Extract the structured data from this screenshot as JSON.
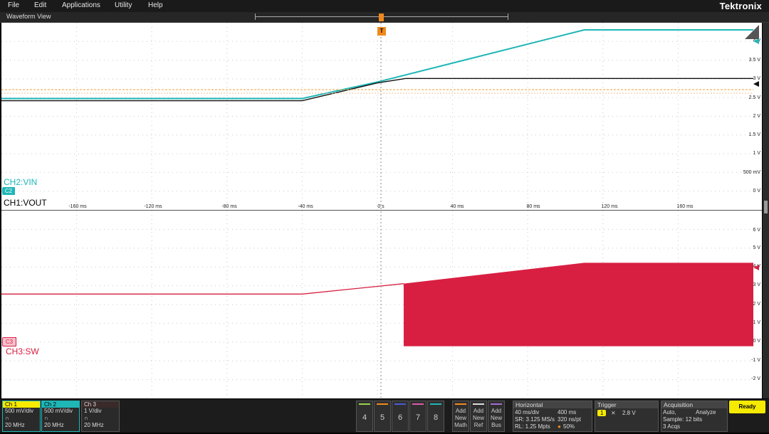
{
  "menubar": {
    "items": [
      "File",
      "Edit",
      "Applications",
      "Utility",
      "Help"
    ],
    "brand": "Tektronix"
  },
  "waveform_view": {
    "title": "Waveform View",
    "trigger_marker": "T",
    "channels": {
      "ch2": {
        "label": "CH2:VIN",
        "badge": "C2",
        "color": "#1fb6b6"
      },
      "ch1": {
        "label": "CH1:VOUT",
        "color": "#111111"
      },
      "ch3": {
        "label": "CH3:SW",
        "badge": "C3",
        "color": "#d81f42"
      }
    },
    "upper_volt_labels": [
      "4 V",
      "3.5 V",
      "3 V",
      "2.5 V",
      "2 V",
      "1.5 V",
      "1 V",
      "500 mV",
      "0 V"
    ],
    "lower_volt_labels": [
      "6 V",
      "5 V",
      "4 V",
      "3 V",
      "2 V",
      "1 V",
      "0 V",
      "-1 V",
      "-2 V"
    ],
    "time_labels": [
      "-160 ms",
      "-120 ms",
      "-80 ms",
      "-40 ms",
      "0 s",
      "40 ms",
      "80 ms",
      "120 ms",
      "160 ms"
    ]
  },
  "chart_data": {
    "type": "line",
    "x_unit": "ms",
    "xlim": [
      -200,
      200
    ],
    "panels": [
      {
        "ylim": [
          0,
          4.2
        ],
        "series": [
          {
            "name": "CH2:VIN",
            "color": "#1fb6b6",
            "x": [
              -200,
              -40,
              0,
              110,
              200
            ],
            "y": [
              2.5,
              2.5,
              2.87,
              4.04,
              4.04
            ]
          },
          {
            "name": "CH1:VOUT",
            "color": "#111111",
            "x": [
              -200,
              -40,
              0,
              15,
              200
            ],
            "y": [
              2.45,
              2.45,
              2.85,
              2.95,
              2.95
            ]
          }
        ]
      },
      {
        "ylim": [
          -2.5,
          6.5
        ],
        "series": [
          {
            "name": "CH3:SW",
            "color": "#d81f42",
            "x": [
              -200,
              -40,
              14,
              14,
              110,
              200
            ],
            "y": [
              2.5,
              2.5,
              3.0,
              0,
              4.0,
              4.0
            ],
            "switching_from_ms": 14
          }
        ]
      }
    ]
  },
  "bottom": {
    "ch1": {
      "title": "Ch 1",
      "scale": "500 mV/div",
      "bw": "20 MHz"
    },
    "ch2": {
      "title": "Ch 2",
      "scale": "500 mV/div",
      "bw": "20 MHz"
    },
    "ch3": {
      "title": "Ch 3",
      "scale": "1 V/div",
      "bw": "20 MHz"
    },
    "num_buttons": [
      "4",
      "5",
      "6",
      "7",
      "8"
    ],
    "num_colors": [
      "#9ad34a",
      "#f28a1e",
      "#4b5bd6",
      "#e05aa8",
      "#1fb6b6"
    ],
    "add_math": [
      "Add",
      "New",
      "Math"
    ],
    "add_ref": [
      "Add",
      "New",
      "Ref"
    ],
    "add_bus": [
      "Add",
      "New",
      "Bus"
    ],
    "horizontal": {
      "title": "Horizontal",
      "div": "40 ms/div",
      "dur": "400 ms",
      "sr": "SR: 3.125 MS/s",
      "ptrate": "320 ns/pt",
      "rl": "RL: 1.25 Mpts",
      "pos": "50%"
    },
    "trigger": {
      "title": "Trigger",
      "ch": "1",
      "level": "2.8 V"
    },
    "acquisition": {
      "title": "Acquisition",
      "mode": "Auto,",
      "analyze": "Analyze",
      "sample": "Sample: 12 bits",
      "acqs": "3 Acqs"
    },
    "ready": "Ready"
  }
}
